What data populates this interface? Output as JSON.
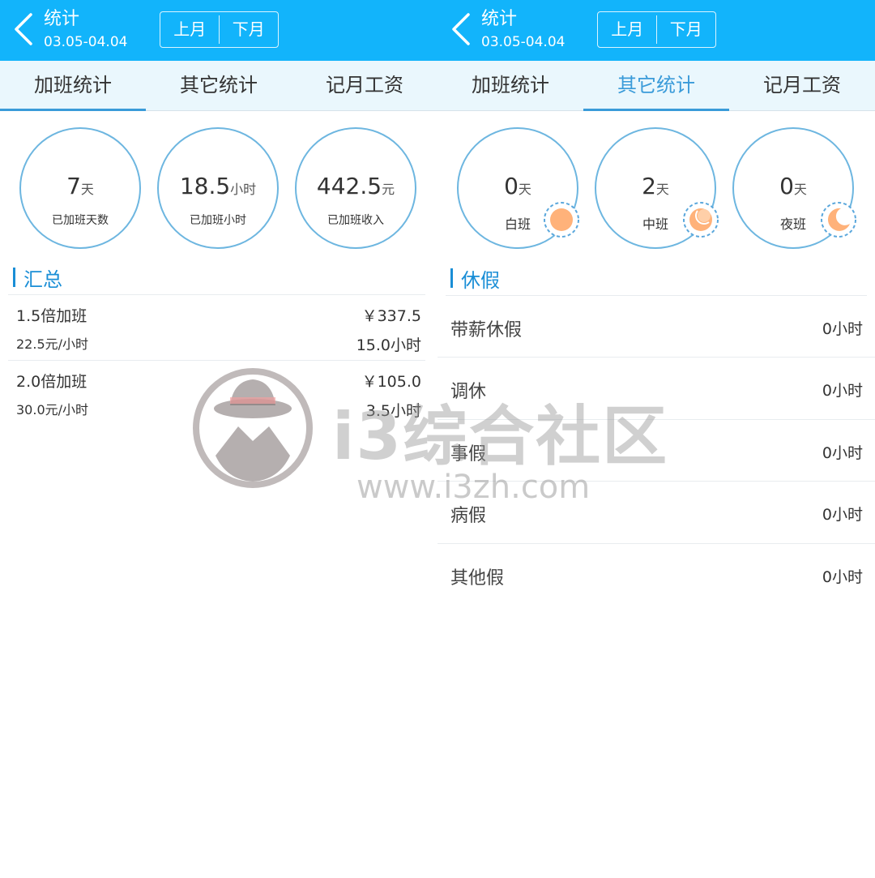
{
  "left": {
    "header": {
      "title": "统计",
      "range": "03.05-04.04",
      "prev_month": "上月",
      "next_month": "下月"
    },
    "tabs": [
      "加班统计",
      "其它统计",
      "记月工资"
    ],
    "stats": [
      {
        "num": "7",
        "unit": "天",
        "label": "已加班天数"
      },
      {
        "num": "18.5",
        "unit": "小时",
        "label": "已加班小时"
      },
      {
        "num": "442.5",
        "unit": "元",
        "label": "已加班收入"
      }
    ],
    "section_title": "汇总",
    "overtime": [
      {
        "name": "1.5倍加班",
        "amount": "￥337.5",
        "rate": "22.5元/小时",
        "hours": "15.0小时"
      },
      {
        "name": "2.0倍加班",
        "amount": "￥105.0",
        "rate": "30.0元/小时",
        "hours": "3.5小时"
      }
    ]
  },
  "right": {
    "header": {
      "title": "统计",
      "range": "03.05-04.04",
      "prev_month": "上月",
      "next_month": "下月"
    },
    "tabs": [
      "加班统计",
      "其它统计",
      "记月工资"
    ],
    "shifts": [
      {
        "num": "0",
        "unit": "天",
        "label": "白班",
        "icon": "sun-icon"
      },
      {
        "num": "2",
        "unit": "天",
        "label": "中班",
        "icon": "half-moon-icon"
      },
      {
        "num": "0",
        "unit": "天",
        "label": "夜班",
        "icon": "crescent-moon-icon"
      }
    ],
    "section_title": "休假",
    "leaves": [
      {
        "name": "带薪休假",
        "value": "0小时"
      },
      {
        "name": "调休",
        "value": "0小时"
      },
      {
        "name": "事假",
        "value": "0小时"
      },
      {
        "name": "病假",
        "value": "0小时"
      },
      {
        "name": "其他假",
        "value": "0小时"
      }
    ]
  },
  "watermark": {
    "text": "i3综合社区",
    "url": "www.i3zh.com"
  },
  "colors": {
    "header": "#12b4fb",
    "accent": "#3a9bd9",
    "shift_icon": "#ffb27a"
  }
}
